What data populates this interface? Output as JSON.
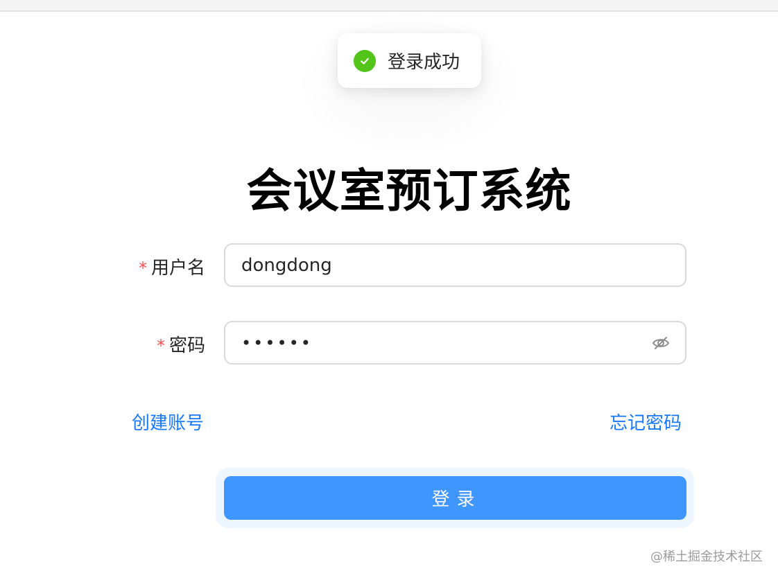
{
  "toast": {
    "icon": "check-circle-icon",
    "message": "登录成功",
    "color": "#52c41a"
  },
  "page": {
    "title": "会议室预订系统"
  },
  "form": {
    "required_mark": "*",
    "username": {
      "label": "用户名",
      "value": "dongdong"
    },
    "password": {
      "label": "密码",
      "value": "••••••",
      "toggle_icon": "eye-invisible-icon"
    }
  },
  "links": {
    "register": "创建账号",
    "forgot": "忘记密码"
  },
  "login_button": {
    "label": "登录",
    "color": "#4096ff"
  },
  "watermark": "@稀土掘金技术社区",
  "colors": {
    "link": "#1677ff",
    "required": "#ff4d4f"
  }
}
